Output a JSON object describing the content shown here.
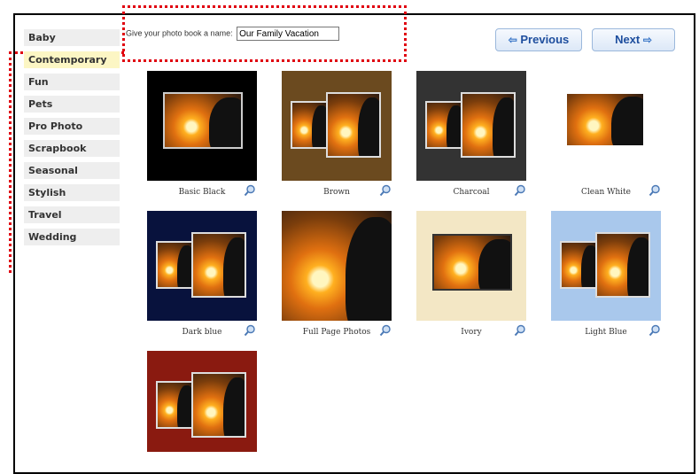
{
  "sidebar": {
    "items": [
      {
        "label": "Baby",
        "active": false
      },
      {
        "label": "Contemporary",
        "active": true
      },
      {
        "label": "Fun",
        "active": false
      },
      {
        "label": "Pets",
        "active": false
      },
      {
        "label": "Pro Photo",
        "active": false
      },
      {
        "label": "Scrapbook",
        "active": false
      },
      {
        "label": "Seasonal",
        "active": false
      },
      {
        "label": "Stylish",
        "active": false
      },
      {
        "label": "Travel",
        "active": false
      },
      {
        "label": "Wedding",
        "active": false
      }
    ]
  },
  "name_field": {
    "label": "Give your photo book a name:",
    "value": "Our Family Vacation"
  },
  "nav": {
    "previous_label": "Previous",
    "next_label": "Next"
  },
  "themes": [
    {
      "label": "Basic Black",
      "bg": "#000000"
    },
    {
      "label": "Brown",
      "bg": "#6b4a1f"
    },
    {
      "label": "Charcoal",
      "bg": "#333333"
    },
    {
      "label": "Clean White",
      "bg": "#ffffff"
    },
    {
      "label": "Dark blue",
      "bg": "#08123d"
    },
    {
      "label": "Full Page Photos",
      "bg": "#c8601a"
    },
    {
      "label": "Ivory",
      "bg": "#f3e7c5"
    },
    {
      "label": "Light Blue",
      "bg": "#a9c8ec"
    },
    {
      "label": "",
      "bg": "#8a1a10"
    }
  ],
  "annotation_color": "#e0000f"
}
